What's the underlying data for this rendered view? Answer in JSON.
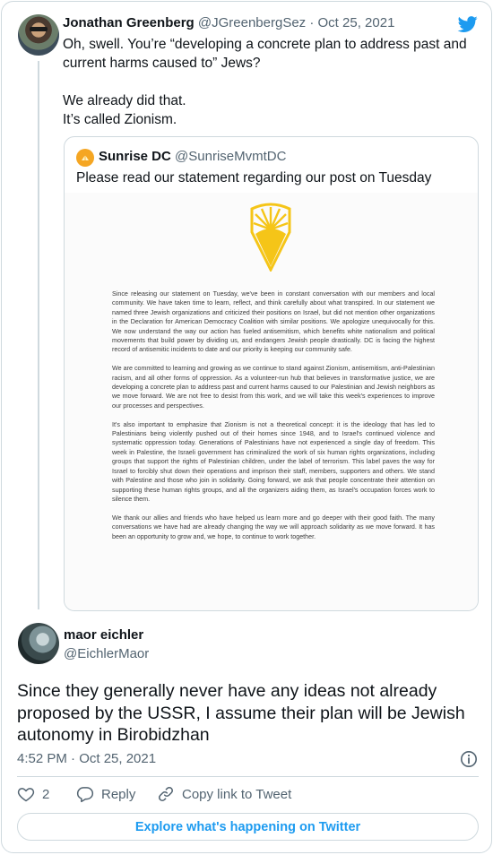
{
  "parent_tweet": {
    "display_name": "Jonathan Greenberg",
    "handle": "@JGreenbergSez",
    "separator": "·",
    "date": "Oct 25, 2021",
    "lines": [
      "Oh, swell. You’re “developing a concrete plan to address past and",
      "current harms caused to” Jews?",
      "We already did that.",
      "It’s called Zionism."
    ]
  },
  "quoted_tweet": {
    "display_name": "Sunrise DC",
    "handle": "@SunriseMvmtDC",
    "text": "Please read our statement regarding our post on Tuesday",
    "statement_paragraphs": [
      "Since releasing our statement on Tuesday, we've been in constant conversation with our members and local community. We have taken time to learn, reflect, and think carefully about what transpired. In our statement we named three Jewish organizations and criticized their positions on Israel, but did not mention other organizations in the Declaration for American Democracy Coalition with similar positions. We apologize unequivocally for this. We now understand the way our action has fueled antisemitism, which benefits white nationalism and political movements that build power by dividing us, and endangers Jewish people drastically. DC is facing the highest record of antisemitic incidents to date and our priority is keeping our community safe.",
      "We are committed to learning and growing as we continue to stand against Zionism, antisemitism, anti-Palestinian racism, and all other forms of oppression. As a volunteer-run hub that believes in transformative justice, we are developing a concrete plan to address past and current harms caused to our Palestinian and Jewish neighbors as we move forward. We are not free to desist from this work, and we will take this week's experiences to improve our processes and perspectives.",
      "It's also important to emphasize that Zionism is not a theoretical concept: it is the ideology that has led to Palestinians being violently pushed out of their homes since 1948, and to Israel's continued violence and systematic oppression today. Generations of Palestinians have not experienced a single day of freedom. This week in Palestine, the Israeli government has criminalized the work of six human rights organizations, including groups that support the rights of Palestinian children, under the label of terrorism. This label paves the way for Israel to forcibly shut down their operations and imprison their staff, members, supporters and others. We stand with Palestine and those who join in solidarity. Going forward, we ask that people concentrate their attention on supporting these human rights groups, and all the organizers aiding them, as Israel's occupation forces work to silence them.",
      "We thank our allies and friends who have helped us learn more and go deeper with their good faith. The many conversations we have had are already changing the way we will approach solidarity as we move forward. It has been an opportunity to grow and, we hope, to continue to work together."
    ]
  },
  "reply_tweet": {
    "display_name": "maor eichler",
    "handle": "@EichlerMaor",
    "text_lines": [
      "Since they generally never have any ideas not already",
      "proposed by the USSR, I assume their plan will be Jewish",
      "autonomy in Birobidzhan"
    ],
    "timestamp": "4:52 PM · Oct 25, 2021",
    "like_count": "2",
    "reply_label": "Reply",
    "copy_link_label": "Copy link to Tweet"
  },
  "explore_label": "Explore what's happening on Twitter",
  "colors": {
    "brand_blue": "#1d9bf0",
    "muted_gray": "#536471",
    "border": "#cfd9de",
    "sunrise_yellow": "#f5c518"
  },
  "icons": [
    "twitter-bird-icon",
    "sunrise-logo-icon",
    "info-icon",
    "heart-icon",
    "reply-icon",
    "link-icon"
  ]
}
